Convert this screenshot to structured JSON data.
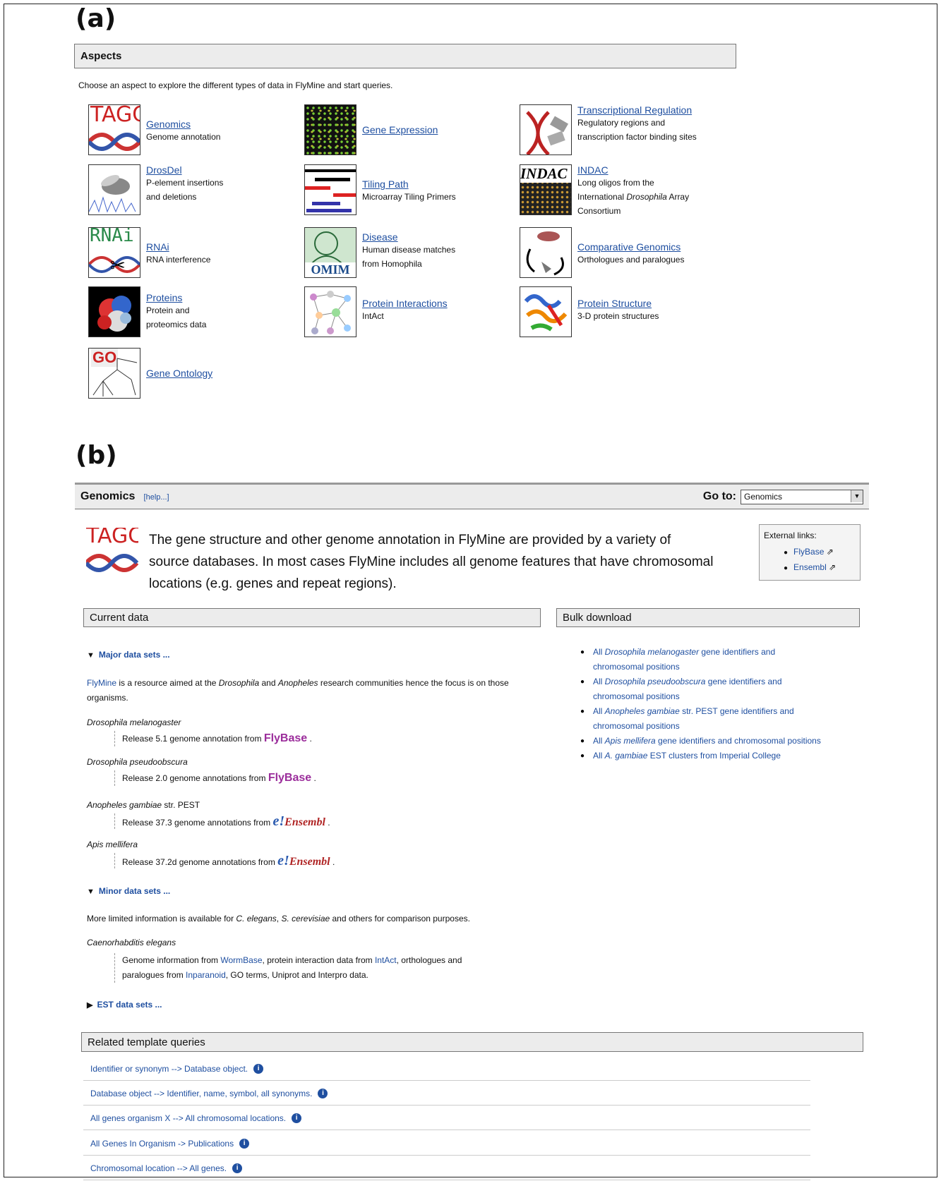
{
  "panel_a_label": "(a)",
  "panel_b_label": "(b)",
  "aspects": {
    "header": "Aspects",
    "intro": "Choose an aspect to explore the different types of data in FlyMine and start queries.",
    "items": [
      {
        "title": "Genomics",
        "desc": "Genome annotation",
        "icon": "tagc-icon"
      },
      {
        "title": "Gene Expression",
        "desc": "",
        "icon": "microarray-icon"
      },
      {
        "title": "Transcriptional Regulation",
        "desc": "Regulatory regions and transcription factor binding sites",
        "icon": "dna-protein-icon"
      },
      {
        "title": "DrosDel",
        "desc": "P-element insertions and deletions",
        "icon": "fly-icon"
      },
      {
        "title": "Tiling Path",
        "desc": "Microarray Tiling Primers",
        "icon": "tiling-icon"
      },
      {
        "title": "INDAC",
        "desc_parts": [
          "Long oligos from the International ",
          "Drosophila",
          " Array Consortium"
        ],
        "icon_text": "INDAC",
        "icon": "indac-icon"
      },
      {
        "title": "RNAi",
        "desc": "RNA interference",
        "icon_text": "RNAi",
        "icon": "rnai-icon"
      },
      {
        "title": "Disease",
        "desc": "Human disease matches from Homophila",
        "icon_text": "OMIM",
        "icon": "omim-icon"
      },
      {
        "title": "Comparative Genomics",
        "desc": "Orthologues and paralogues",
        "icon": "comparative-icon"
      },
      {
        "title": "Proteins",
        "desc": "Protein and proteomics data",
        "icon": "protein-sphere-icon"
      },
      {
        "title": "Protein Interactions",
        "desc": "IntAct",
        "icon": "network-icon"
      },
      {
        "title": "Protein Structure",
        "desc": "3-D protein structures",
        "icon": "ribbon-icon"
      },
      {
        "title": "Gene Ontology",
        "desc": "",
        "icon_text": "GO",
        "icon": "go-icon"
      }
    ],
    "tagc_text": "TAGC"
  },
  "genomics": {
    "title": "Genomics",
    "help": "[help...]",
    "goto_label": "Go to:",
    "goto_value": "Genomics",
    "tagc_text": "TAGC",
    "description": "The gene structure and other genome annotation in FlyMine are provided by a variety of source databases. In most cases FlyMine includes all genome features that have chromosomal locations (e.g. genes and repeat regions).",
    "external_links_label": "External links:",
    "external_links": [
      "FlyBase",
      "Ensembl"
    ],
    "current_data_header": "Current data",
    "bulk_header": "Bulk download",
    "major_label": "Major data sets ...",
    "major_intro_link": "FlyMine",
    "major_intro_rest": " is a resource aimed at the ",
    "major_intro_i1": "Drosophila",
    "major_intro_and": " and ",
    "major_intro_i2": "Anopheles",
    "major_intro_end": " research communities hence the focus is on those organisms.",
    "organisms": [
      {
        "name": "Drosophila melanogaster",
        "release": "Release 5.1 genome annotation from",
        "source": "FlyBase"
      },
      {
        "name": "Drosophila pseudoobscura",
        "release": "Release 2.0 genome annotations from",
        "source": "FlyBase"
      },
      {
        "name": "Anopheles gambiae",
        "suffix": " str. PEST",
        "release": "Release 37.3 genome annotations from",
        "source": "Ensembl"
      },
      {
        "name": "Apis mellifera",
        "release": "Release 37.2d genome annotations from",
        "source": "Ensembl"
      }
    ],
    "ensembl_e": "e!",
    "minor_label": "Minor data sets ...",
    "minor_intro_a": "More limited information is available for ",
    "minor_intro_i1": "C. elegans",
    "minor_intro_b": ", ",
    "minor_intro_i2": "S. cerevisiae",
    "minor_intro_c": " and others for comparison purposes.",
    "ce_name": "Caenorhabditis elegans",
    "ce_a": "Genome information from ",
    "ce_l1": "WormBase",
    "ce_b": ", protein interaction data from ",
    "ce_l2": "IntAct",
    "ce_c": ", orthologues and",
    "ce_d": "paralogues from ",
    "ce_l3": "Inparanoid",
    "ce_e": ", GO terms, Uniprot and Interpro data.",
    "est_label": "EST data sets ...",
    "bulk": [
      {
        "a": "All ",
        "i": "Drosophila melanogaster",
        "b": " gene identifiers and",
        "c": "chromosomal positions"
      },
      {
        "a": "All ",
        "i": "Drosophila pseudoobscura",
        "b": " gene identifiers and",
        "c": "chromosomal positions"
      },
      {
        "a": "All ",
        "i": "Anopheles gambiae",
        "b": " str. PEST gene identifiers and",
        "c": "chromosomal positions"
      },
      {
        "a": "All ",
        "i": "Apis mellifera",
        "b": " gene identifiers and chromosomal positions",
        "c": ""
      },
      {
        "a": "All ",
        "i": "A. gambiae",
        "b": " EST clusters from Imperial College",
        "c": ""
      }
    ],
    "template_header": "Related template queries",
    "templates": [
      "Identifier or synonym --> Database object.",
      "Database object --> Identifier, name, symbol, all synonyms.",
      "All genes organism X --> All chromosomal locations.",
      "All Genes In Organism -> Publications",
      "Chromosomal location --> All genes."
    ],
    "info_glyph": "i"
  }
}
